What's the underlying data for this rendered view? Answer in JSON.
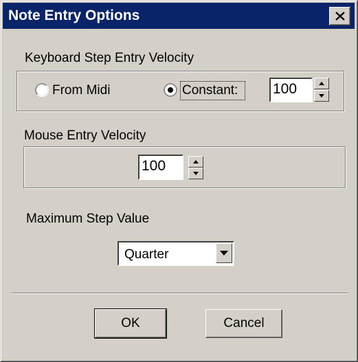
{
  "window": {
    "title": "Note Entry Options",
    "close_glyph": "close-icon",
    "title_bg": "#0a246a"
  },
  "keyboard": {
    "group_label": "Keyboard Step Entry Velocity",
    "from_midi_label": "From Midi",
    "constant_label": "Constant:",
    "selected": "Constant",
    "velocity_value": "100"
  },
  "mouse": {
    "group_label": "Mouse Entry Velocity",
    "velocity_value": "100"
  },
  "step": {
    "label": "Maximum Step Value",
    "selected_value": "Quarter"
  },
  "buttons": {
    "ok_label": "OK",
    "cancel_label": "Cancel"
  }
}
